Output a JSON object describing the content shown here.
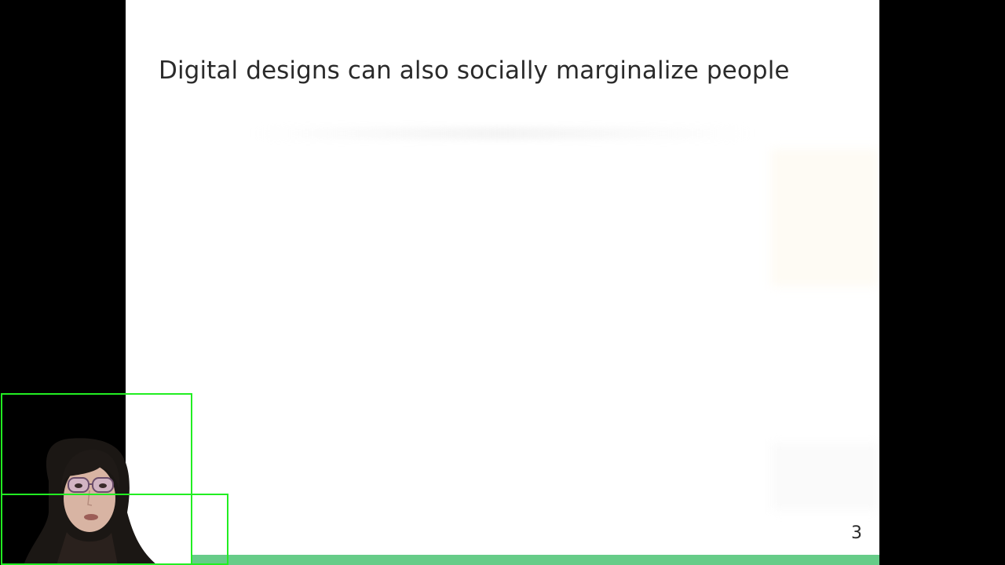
{
  "slide": {
    "title": "Digital designs can also socially marginalize people",
    "page_number": "3"
  },
  "colors": {
    "accent_bar": "#66cc88",
    "detection_box": "#22ee22",
    "letterbox": "#000000",
    "slide_bg": "#ffffff",
    "text": "#2a2a2a"
  },
  "webcam": {
    "icon": "presenter-video-feed"
  }
}
